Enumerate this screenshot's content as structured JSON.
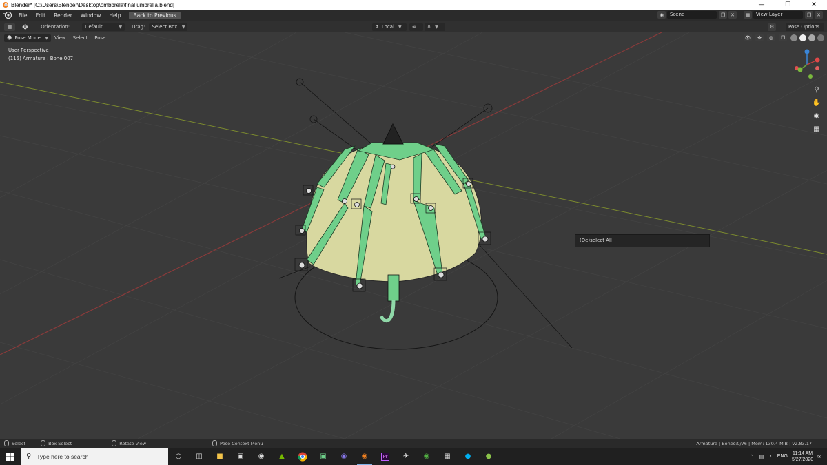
{
  "window": {
    "title": "Blender* [C:\\Users\\Blender\\Desktop\\ombbrela\\final umbrella.blend]",
    "controls": [
      "minimize-icon",
      "maximize-icon",
      "close-icon"
    ]
  },
  "topmenu": {
    "items": [
      "File",
      "Edit",
      "Render",
      "Window",
      "Help"
    ],
    "back_button": "Back to Previous",
    "scene_label": "Scene",
    "view_layer_label": "View Layer"
  },
  "toolheader": {
    "orientation_label": "Orientation:",
    "orientation_value": "Default",
    "drag_label": "Drag:",
    "drag_value": "Select Box",
    "transform_pivot": "Local",
    "options_label": "Pose Options"
  },
  "modebar": {
    "mode": "Pose Mode",
    "menus": [
      "View",
      "Select",
      "Pose"
    ]
  },
  "viewport": {
    "perspective": "User Perspective",
    "active_object": "(115) Armature : Bone.007",
    "popup": "(De)select All",
    "colors": {
      "background": "#3a3a3a",
      "x_axis": "#8a3a3a",
      "y_axis": "#7d8c2e",
      "canopy": "#d8d8a0",
      "bones": "#6fcf8a"
    }
  },
  "statusbar": {
    "items": [
      {
        "icon": "mouse-left-icon",
        "label": "Select"
      },
      {
        "icon": "mouse-left-icon",
        "label": "Box Select"
      },
      {
        "icon": "mouse-middle-icon",
        "label": "Rotate View"
      },
      {
        "icon": "mouse-right-icon",
        "label": "Pose Context Menu"
      }
    ],
    "stats": "Armature | Bones:0/76 | Mem: 130.4 MiB | v2.83.17"
  },
  "taskbar": {
    "search_placeholder": "Type here to search",
    "apps": [
      "cortana-icon",
      "task-view-icon",
      "file-explorer-icon",
      "store-icon",
      "steam-icon",
      "nvidia-icon",
      "chrome-icon",
      "app-icon",
      "app-icon-2",
      "blender-icon",
      "premiere-icon",
      "game-icon",
      "xbox-icon",
      "calculator-icon",
      "skype-icon",
      "app-icon-3"
    ],
    "language": "ENG",
    "time": "11:14 AM",
    "date": "5/27/2020"
  }
}
